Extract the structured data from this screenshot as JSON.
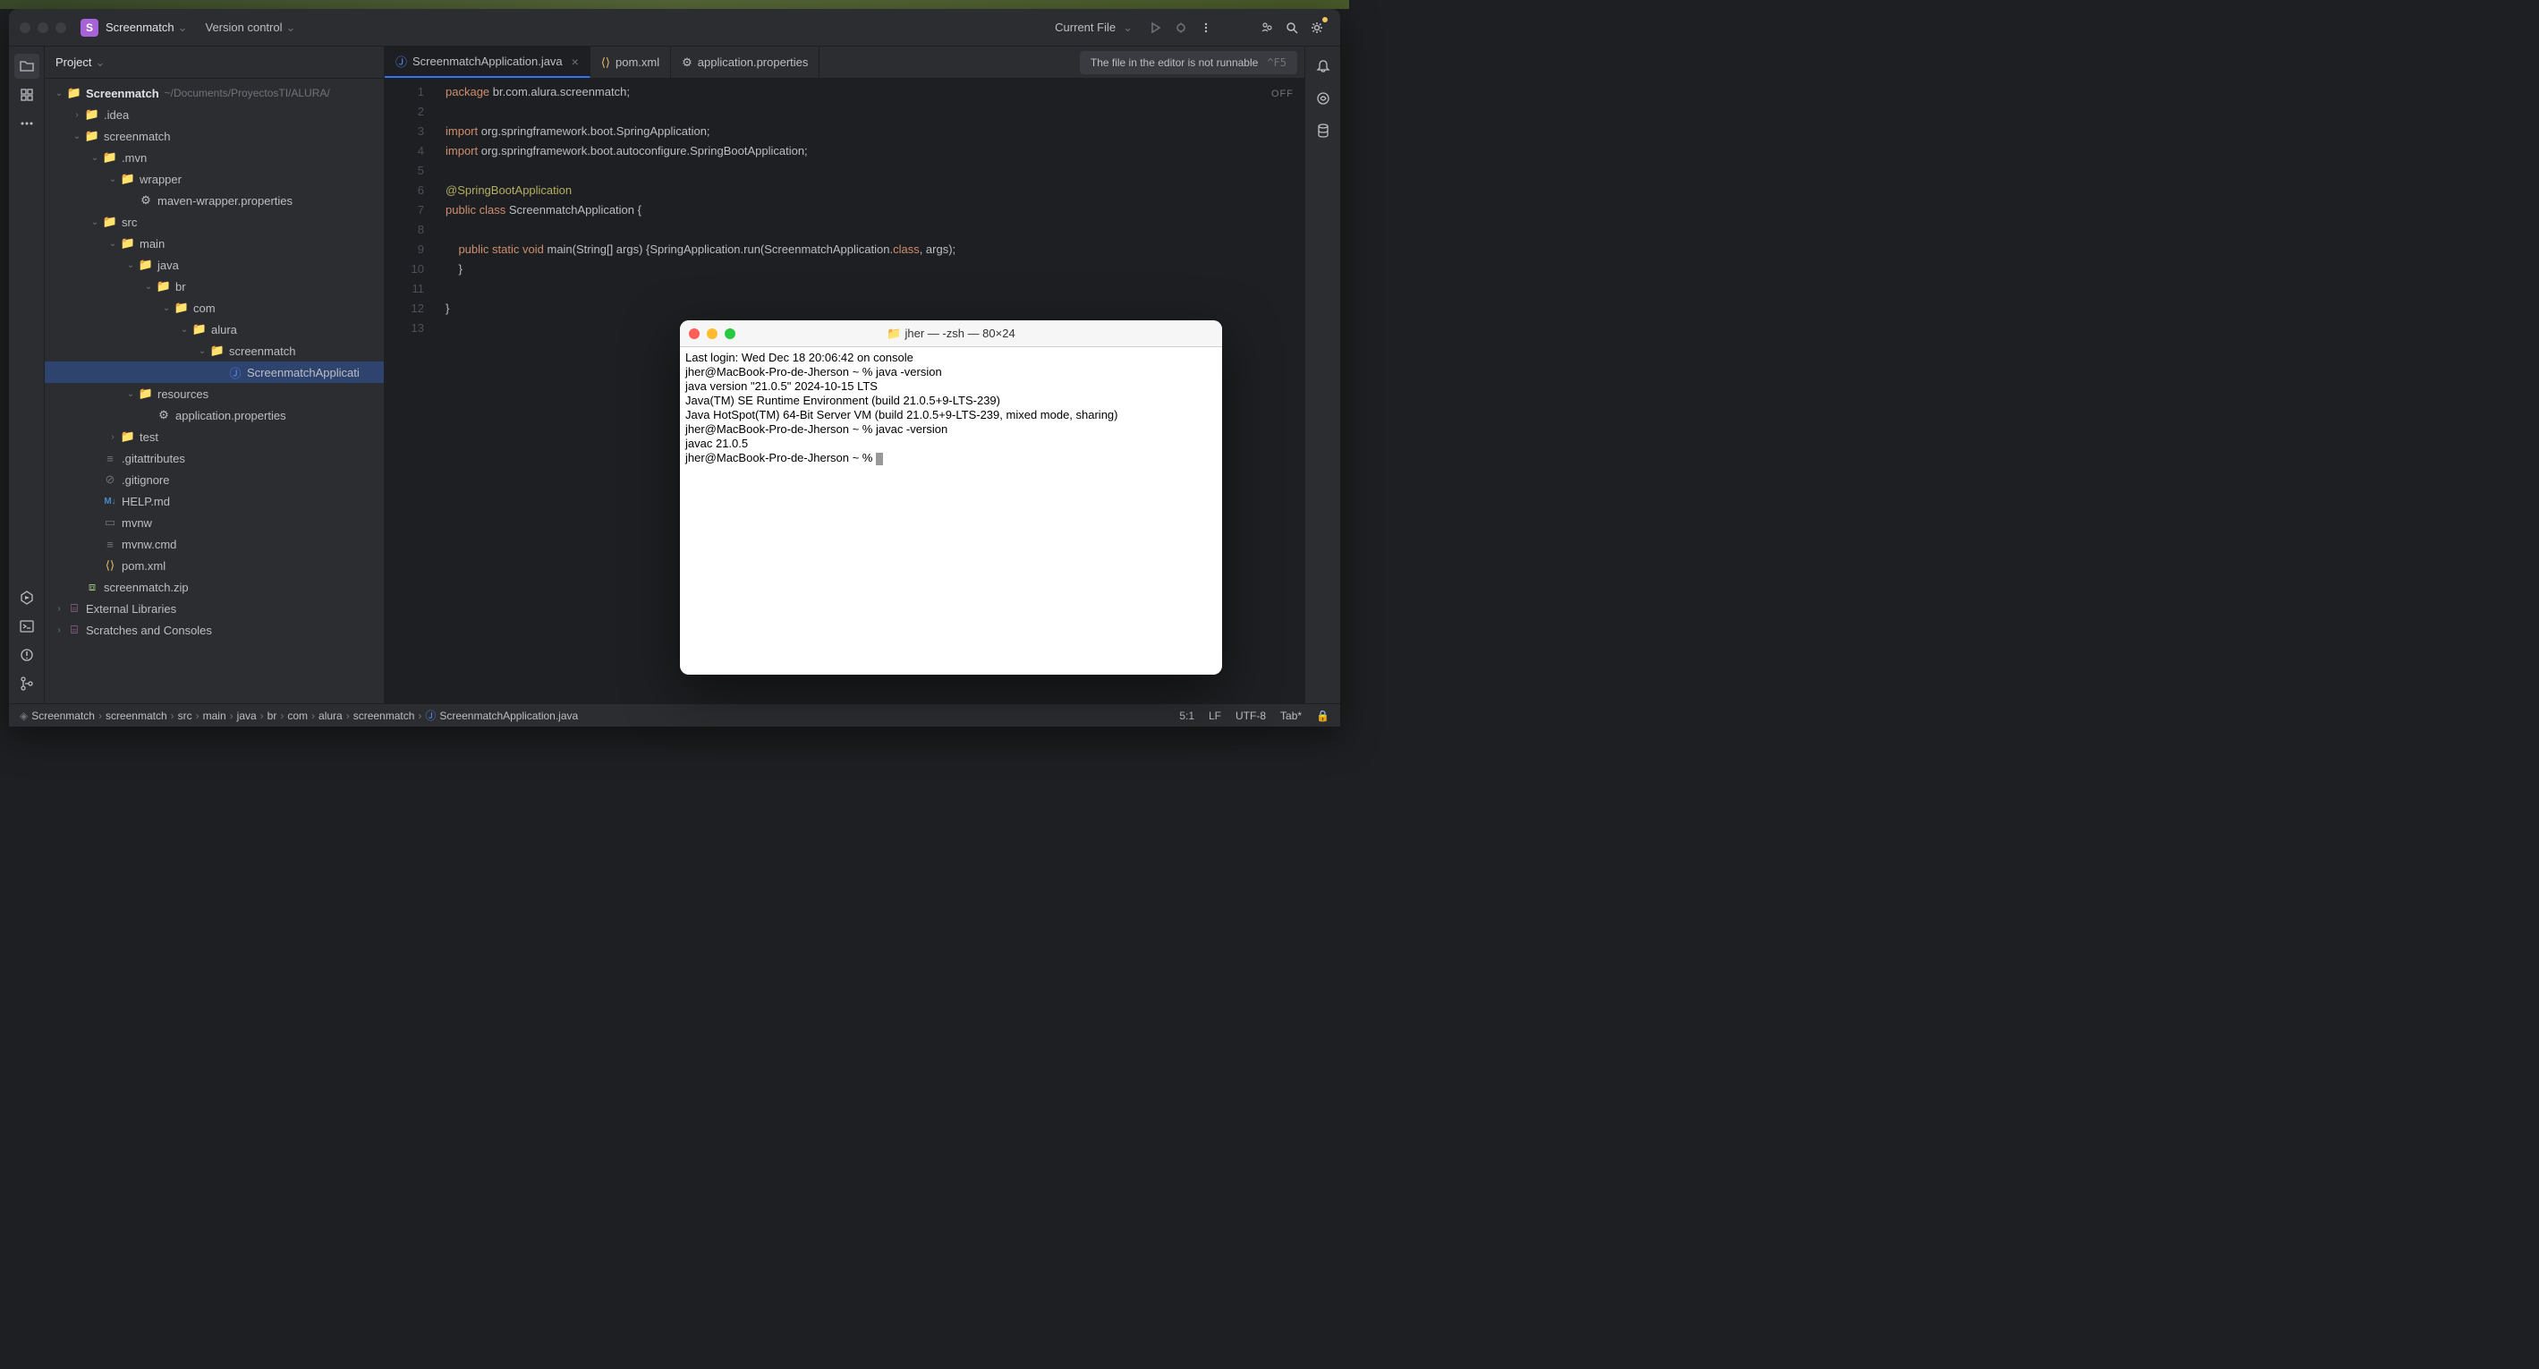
{
  "titlebar": {
    "project_initial": "S",
    "project_name": "Screenmatch",
    "version_control": "Version control",
    "run_config": "Current File"
  },
  "panel": {
    "title": "Project"
  },
  "tree": {
    "root": "Screenmatch",
    "root_hint": "~/Documents/ProyectosTI/ALURA/",
    "idea": ".idea",
    "screenmatch": "screenmatch",
    "mvn": ".mvn",
    "wrapper": "wrapper",
    "maven_wrapper": "maven-wrapper.properties",
    "src": "src",
    "main": "main",
    "java": "java",
    "br": "br",
    "com": "com",
    "alura": "alura",
    "screenmatch2": "screenmatch",
    "app_file": "ScreenmatchApplicati",
    "resources": "resources",
    "app_props": "application.properties",
    "test": "test",
    "gitattributes": ".gitattributes",
    "gitignore": ".gitignore",
    "help": "HELP.md",
    "mvnw": "mvnw",
    "mvnw_cmd": "mvnw.cmd",
    "pom": "pom.xml",
    "zip": "screenmatch.zip",
    "ext_libs": "External Libraries",
    "scratches": "Scratches and Consoles"
  },
  "tabs": {
    "t1": "ScreenmatchApplication.java",
    "t2": "pom.xml",
    "t3": "application.properties"
  },
  "notification": {
    "text": "The file in the editor is not runnable",
    "shortcut": "^F5"
  },
  "editor": {
    "off": "OFF",
    "lines": {
      "l1": "1",
      "l2": "2",
      "l3": "3",
      "l4": "4",
      "l5": "5",
      "l6": "6",
      "l7": "7",
      "l8": "8",
      "l9": "9",
      "l10": "10",
      "l11": "11",
      "l12": "12",
      "l13": "13"
    }
  },
  "breadcrumb": {
    "b0": "Screenmatch",
    "b1": "screenmatch",
    "b2": "src",
    "b3": "main",
    "b4": "java",
    "b5": "br",
    "b6": "com",
    "b7": "alura",
    "b8": "screenmatch",
    "b9": "ScreenmatchApplication.java"
  },
  "status": {
    "pos": "5:1",
    "lf": "LF",
    "enc": "UTF-8",
    "indent": "Tab*"
  },
  "terminal": {
    "title": "jher — -zsh — 80×24",
    "content": "Last login: Wed Dec 18 20:06:42 on console\njher@MacBook-Pro-de-Jherson ~ % java -version\njava version \"21.0.5\" 2024-10-15 LTS\nJava(TM) SE Runtime Environment (build 21.0.5+9-LTS-239)\nJava HotSpot(TM) 64-Bit Server VM (build 21.0.5+9-LTS-239, mixed mode, sharing)\njher@MacBook-Pro-de-Jherson ~ % javac -version\njavac 21.0.5\njher@MacBook-Pro-de-Jherson ~ % "
  }
}
